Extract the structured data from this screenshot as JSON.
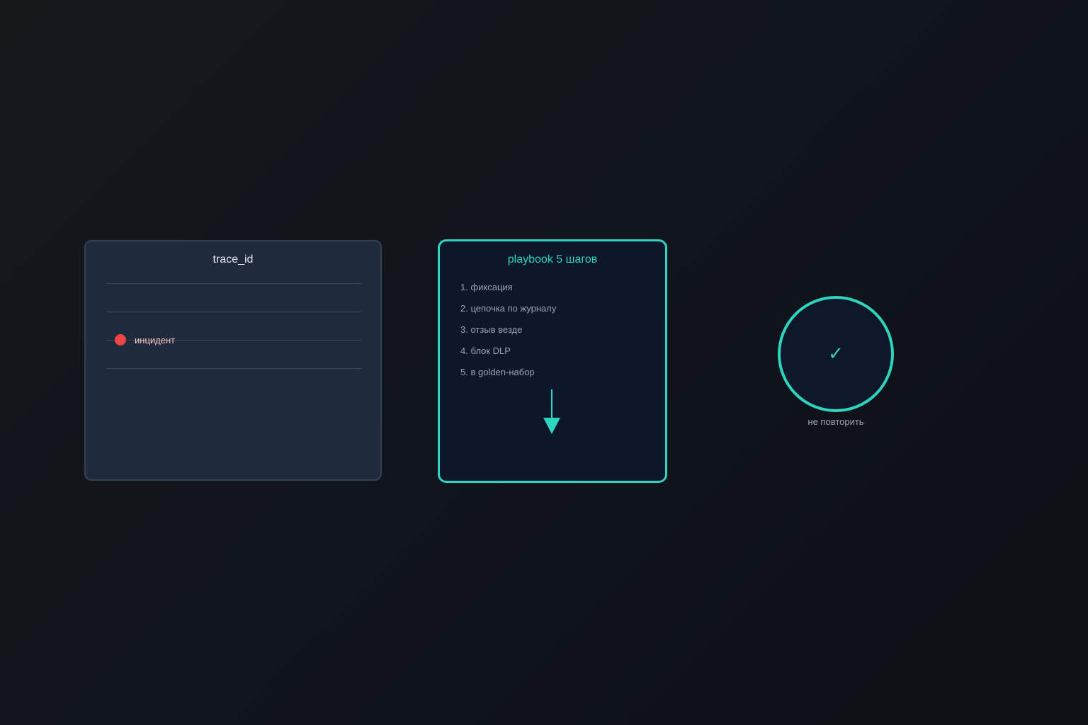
{
  "trace_card": {
    "title": "trace_id",
    "incident_label": "инцидент"
  },
  "playbook_card": {
    "title": "playbook 5 шагов",
    "steps": [
      "1. фиксация",
      "2. цепочка по журналу",
      "3. отзыв везде",
      "4. блок DLP",
      "5. в golden-набор"
    ]
  },
  "badge": {
    "icon": "check-icon",
    "symbol": "✓",
    "label": "не повторить"
  },
  "colors": {
    "accent": "#2dd4bf",
    "incident": "#ef4444",
    "card_bg": "#1f2a3c",
    "playbook_bg": "#0e1729"
  }
}
